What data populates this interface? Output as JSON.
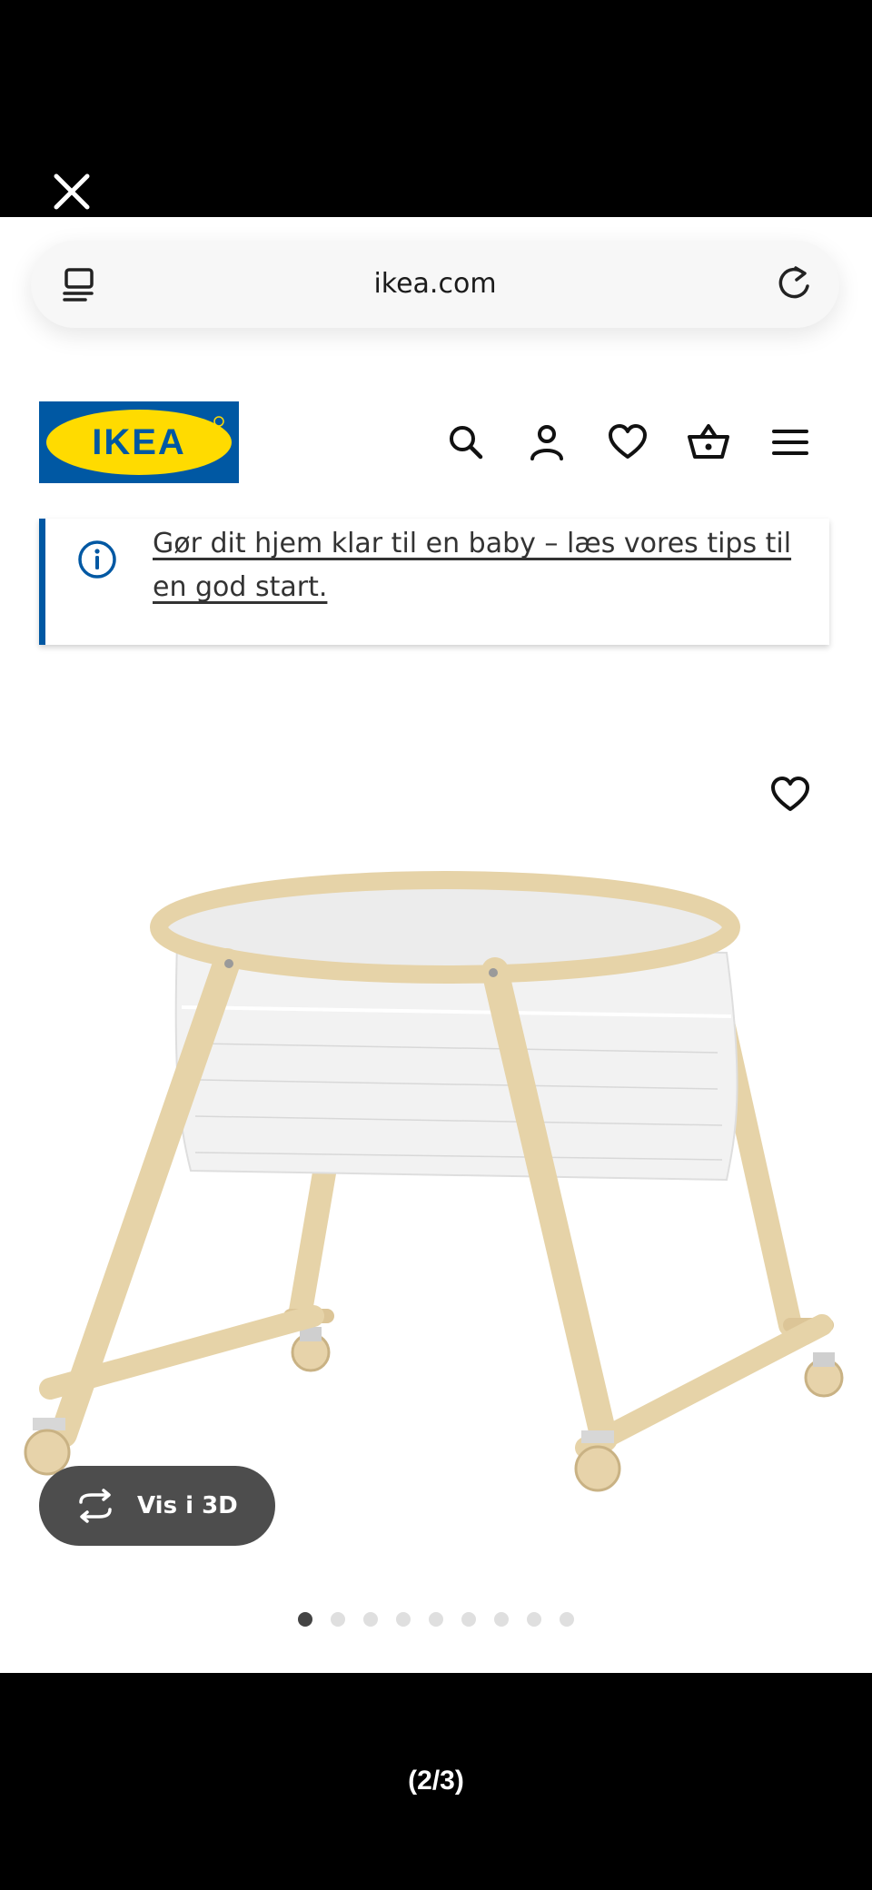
{
  "viewer": {
    "close_icon": "close-icon",
    "counter": "(2/3)"
  },
  "browser": {
    "url": "ikea.com",
    "tabs_icon": "tabs-icon",
    "reload_icon": "reload-icon"
  },
  "header": {
    "logo_text": "IKEA",
    "brand_colors": {
      "blue": "#0058a3",
      "yellow": "#ffdb00"
    },
    "icons": [
      "search-icon",
      "account-icon",
      "heart-icon",
      "basket-icon",
      "menu-icon"
    ]
  },
  "banner": {
    "text": "Gør dit hjem klar til en baby – læs vores tips til en god start.",
    "accent": "#0058a3",
    "icon": "info-icon"
  },
  "product": {
    "favorite_icon": "heart-icon",
    "vis3d_label": "Vis i 3D",
    "vis3d_icon": "rotate-3d-icon",
    "carousel": {
      "total": 9,
      "active_index": 0
    }
  }
}
